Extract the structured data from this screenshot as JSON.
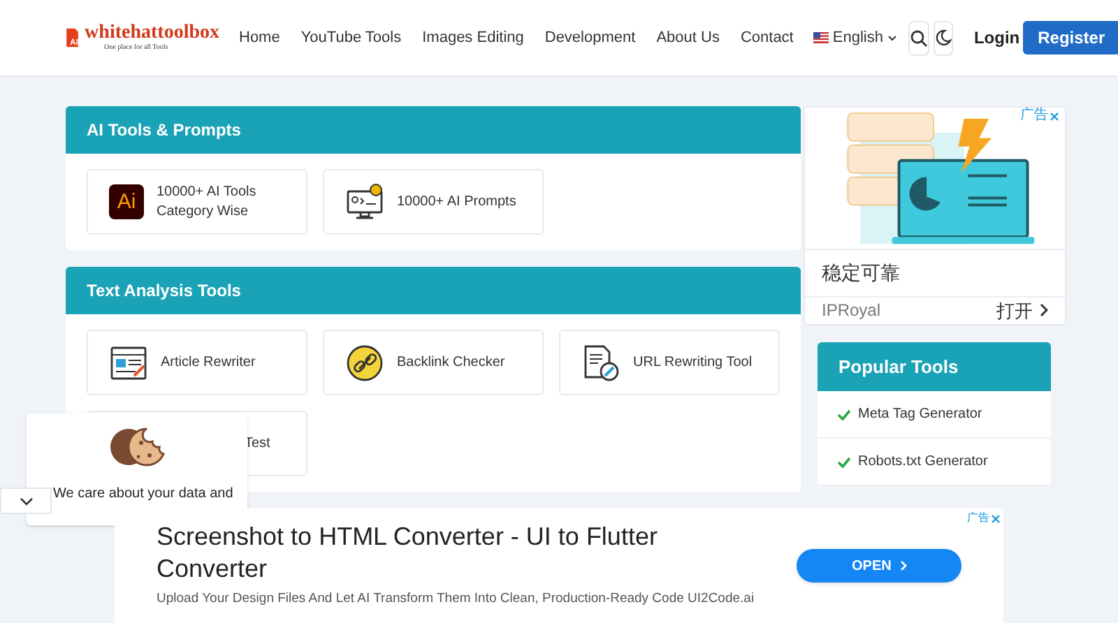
{
  "header": {
    "logo": {
      "badge": "AI",
      "name": "whitehattoolbox",
      "tagline": "One place for all Tools"
    },
    "nav": [
      "Home",
      "YouTube Tools",
      "Images Editing",
      "Development",
      "About Us",
      "Contact"
    ],
    "language": "English",
    "login": "Login",
    "register": "Register"
  },
  "sections": [
    {
      "title": "AI Tools & Prompts",
      "cards": [
        {
          "kind": "ai",
          "badge": "Ai",
          "label": "10000+ AI Tools Category Wise"
        },
        {
          "kind": "monitor",
          "label": "10000+ AI Prompts"
        }
      ]
    },
    {
      "title": "Text Analysis Tools",
      "cards": [
        {
          "kind": "article",
          "label": "Article Rewriter"
        },
        {
          "kind": "link",
          "label": "Backlink Checker"
        },
        {
          "kind": "url",
          "label": "URL Rewriting Tool"
        },
        {
          "kind": "covered",
          "label": "Test"
        }
      ]
    }
  ],
  "side_ad": {
    "badge": "广告",
    "headline": "稳定可靠",
    "advertiser": "IPRoyal",
    "action": "打开"
  },
  "popular": {
    "title": "Popular Tools",
    "items": [
      "Meta Tag Generator",
      "Robots.txt Generator"
    ]
  },
  "cookie": {
    "text": "We care about your data and"
  },
  "bottom_ad": {
    "badge": "广告",
    "title": "Screenshot to HTML Converter - UI to Flutter Converter",
    "description": "Upload Your Design Files And Let AI Transform Them Into Clean, Production-Ready Code UI2Code.ai",
    "button": "OPEN"
  }
}
